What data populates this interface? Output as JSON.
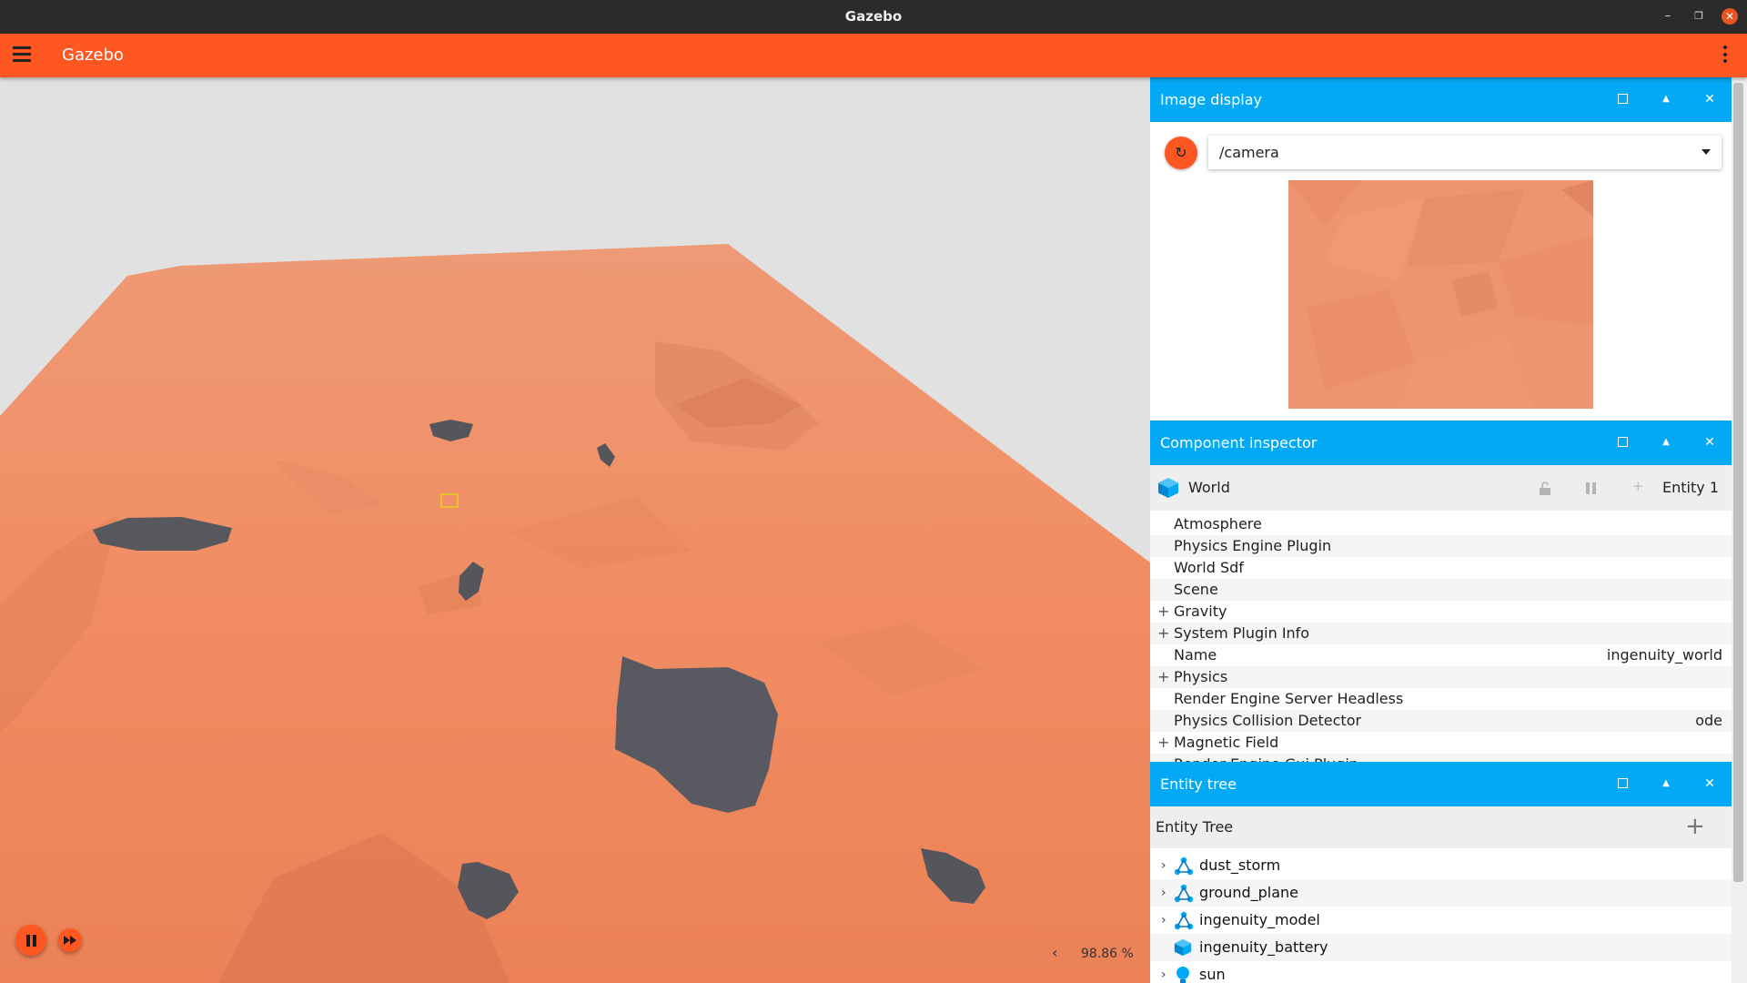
{
  "window": {
    "title": "Gazebo",
    "minimize_icon": "minimize-icon",
    "maximize_icon": "maximize-icon",
    "close_icon": "close-icon"
  },
  "app": {
    "title": "Gazebo",
    "menu_icon": "hamburger-menu-icon",
    "overflow_icon": "kebab-menu-icon",
    "accent_color": "#ff5722"
  },
  "viewport": {
    "rtf_label": "98.86 %",
    "collapse_glyph": "‹",
    "ground_color": "#f0906a",
    "sky_color": "#e1e1e1",
    "rock_color": "#55565c"
  },
  "image_display": {
    "title": "Image display",
    "topic": "/camera",
    "refresh_glyph": "↻",
    "header_color": "#03a9f4"
  },
  "component_inspector": {
    "title": "Component inspector",
    "entity_name": "World",
    "entity_id": "Entity 1",
    "components": [
      {
        "label": "Atmosphere",
        "expandable": false,
        "value": ""
      },
      {
        "label": "Physics Engine Plugin",
        "expandable": false,
        "value": ""
      },
      {
        "label": "World Sdf",
        "expandable": false,
        "value": ""
      },
      {
        "label": "Scene",
        "expandable": false,
        "value": ""
      },
      {
        "label": "Gravity",
        "expandable": true,
        "value": ""
      },
      {
        "label": "System Plugin Info",
        "expandable": true,
        "value": ""
      },
      {
        "label": "Name",
        "expandable": false,
        "value": "ingenuity_world"
      },
      {
        "label": "Physics",
        "expandable": true,
        "value": ""
      },
      {
        "label": "Render Engine Server Headless",
        "expandable": false,
        "value": ""
      },
      {
        "label": "Physics Collision Detector",
        "expandable": false,
        "value": "ode"
      },
      {
        "label": "Magnetic Field",
        "expandable": true,
        "value": ""
      },
      {
        "label": "Render Engine Gui Plugin",
        "expandable": false,
        "value": ""
      }
    ]
  },
  "entity_tree": {
    "title": "Entity tree",
    "header": "Entity Tree",
    "add_glyph": "+",
    "items": [
      {
        "label": "dust_storm",
        "icon": "model-icon",
        "expandable": true
      },
      {
        "label": "ground_plane",
        "icon": "model-icon",
        "expandable": true
      },
      {
        "label": "ingenuity_model",
        "icon": "model-icon",
        "expandable": true
      },
      {
        "label": "ingenuity_battery",
        "icon": "cube-icon",
        "expandable": false
      },
      {
        "label": "sun",
        "icon": "light-icon",
        "expandable": true
      }
    ]
  }
}
